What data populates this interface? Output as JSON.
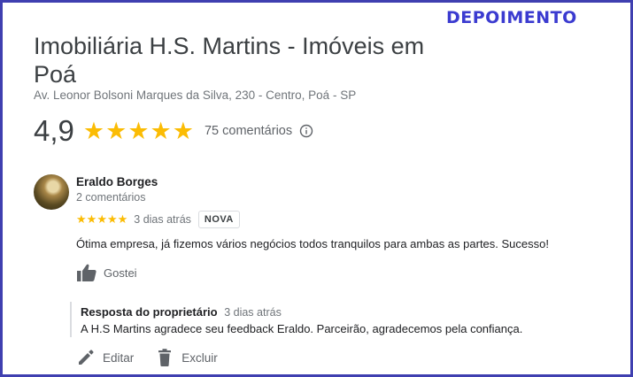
{
  "tag": "DEPOIMENTO",
  "business": {
    "name": "Imobiliária H.S. Martins - Imóveis em Poá",
    "address": "Av. Leonor Bolsoni Marques da Silva, 230 - Centro, Poá - SP",
    "rating": "4,9",
    "stars": 5,
    "reviews_count": "75 comentários"
  },
  "review": {
    "author": "Eraldo Borges",
    "author_meta": "2 comentários",
    "stars": 5,
    "when": "3 dias atrás",
    "badge": "NOVA",
    "text": "Ótima empresa, já fizemos vários negócios todos tranquilos para ambas as partes. Sucesso!",
    "like_label": "Gostei"
  },
  "reply": {
    "owner_label": "Resposta do proprietário",
    "when": "3 dias atrás",
    "text": "A H.S Martins agradece seu feedback Eraldo. Parceirão, agradecemos pela confiança."
  },
  "actions": {
    "edit_label": "Editar",
    "delete_label": "Excluir"
  },
  "icons": {
    "star": "star-icon",
    "info": "info-icon",
    "like": "thumbs-up-icon",
    "edit": "pencil-icon",
    "delete": "trash-icon"
  },
  "colors": {
    "star": "#fbbc04",
    "tag": "#3b3bd0",
    "frame": "#3f3fb0"
  }
}
